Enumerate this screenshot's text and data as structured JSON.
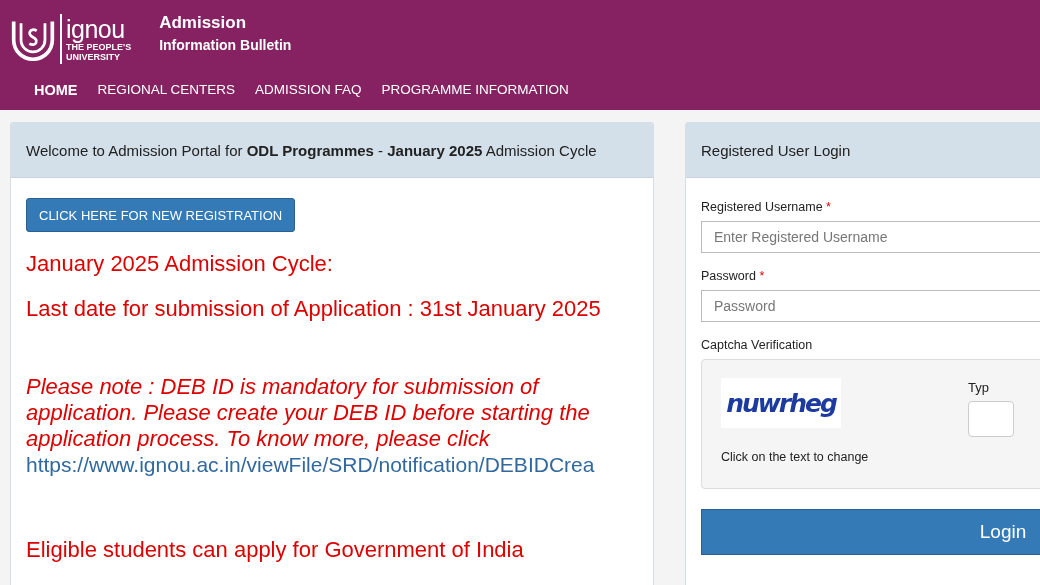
{
  "header": {
    "logo": {
      "name": "ignou",
      "tagline_1": "THE PEOPLE'S",
      "tagline_2": "UNIVERSITY"
    },
    "title": "Admission",
    "subtitle": "Information Bulletin"
  },
  "nav": [
    {
      "label": "HOME",
      "selected": true
    },
    {
      "label": "REGIONAL CENTERS",
      "selected": false
    },
    {
      "label": "ADMISSION FAQ",
      "selected": false
    },
    {
      "label": "PROGRAMME INFORMATION",
      "selected": false
    }
  ],
  "welcome_panel": {
    "heading": "Welcome to Admission Portal for **ODL Programmes** - **January 2025** Admission Cycle",
    "register_button": "CLICK HERE FOR NEW REGISTRATION",
    "cycle_heading": "January 2025 Admission Cycle:",
    "last_date": "Last date for submission of Application : 31st January 2025",
    "note": "Please note : DEB ID is mandatory for submission of application. Please create your DEB ID before starting the application process. To know more, please click",
    "note_link": "https://www.ignou.ac.in/viewFile/SRD/notification/DEBIDCrea",
    "eligibility": "Eligible students can apply for Government of India"
  },
  "login_panel": {
    "heading": "Registered User Login",
    "username_label": "Registered Username",
    "username_placeholder": "Enter Registered Username",
    "password_label": "Password",
    "password_placeholder": "Password",
    "required_mark": "*",
    "captcha_label": "Captcha Verification",
    "captcha_text": "nuwrheg",
    "captcha_hint": "Click on the text to change",
    "captcha_input_label": "Typ",
    "login_button": "Login"
  }
}
